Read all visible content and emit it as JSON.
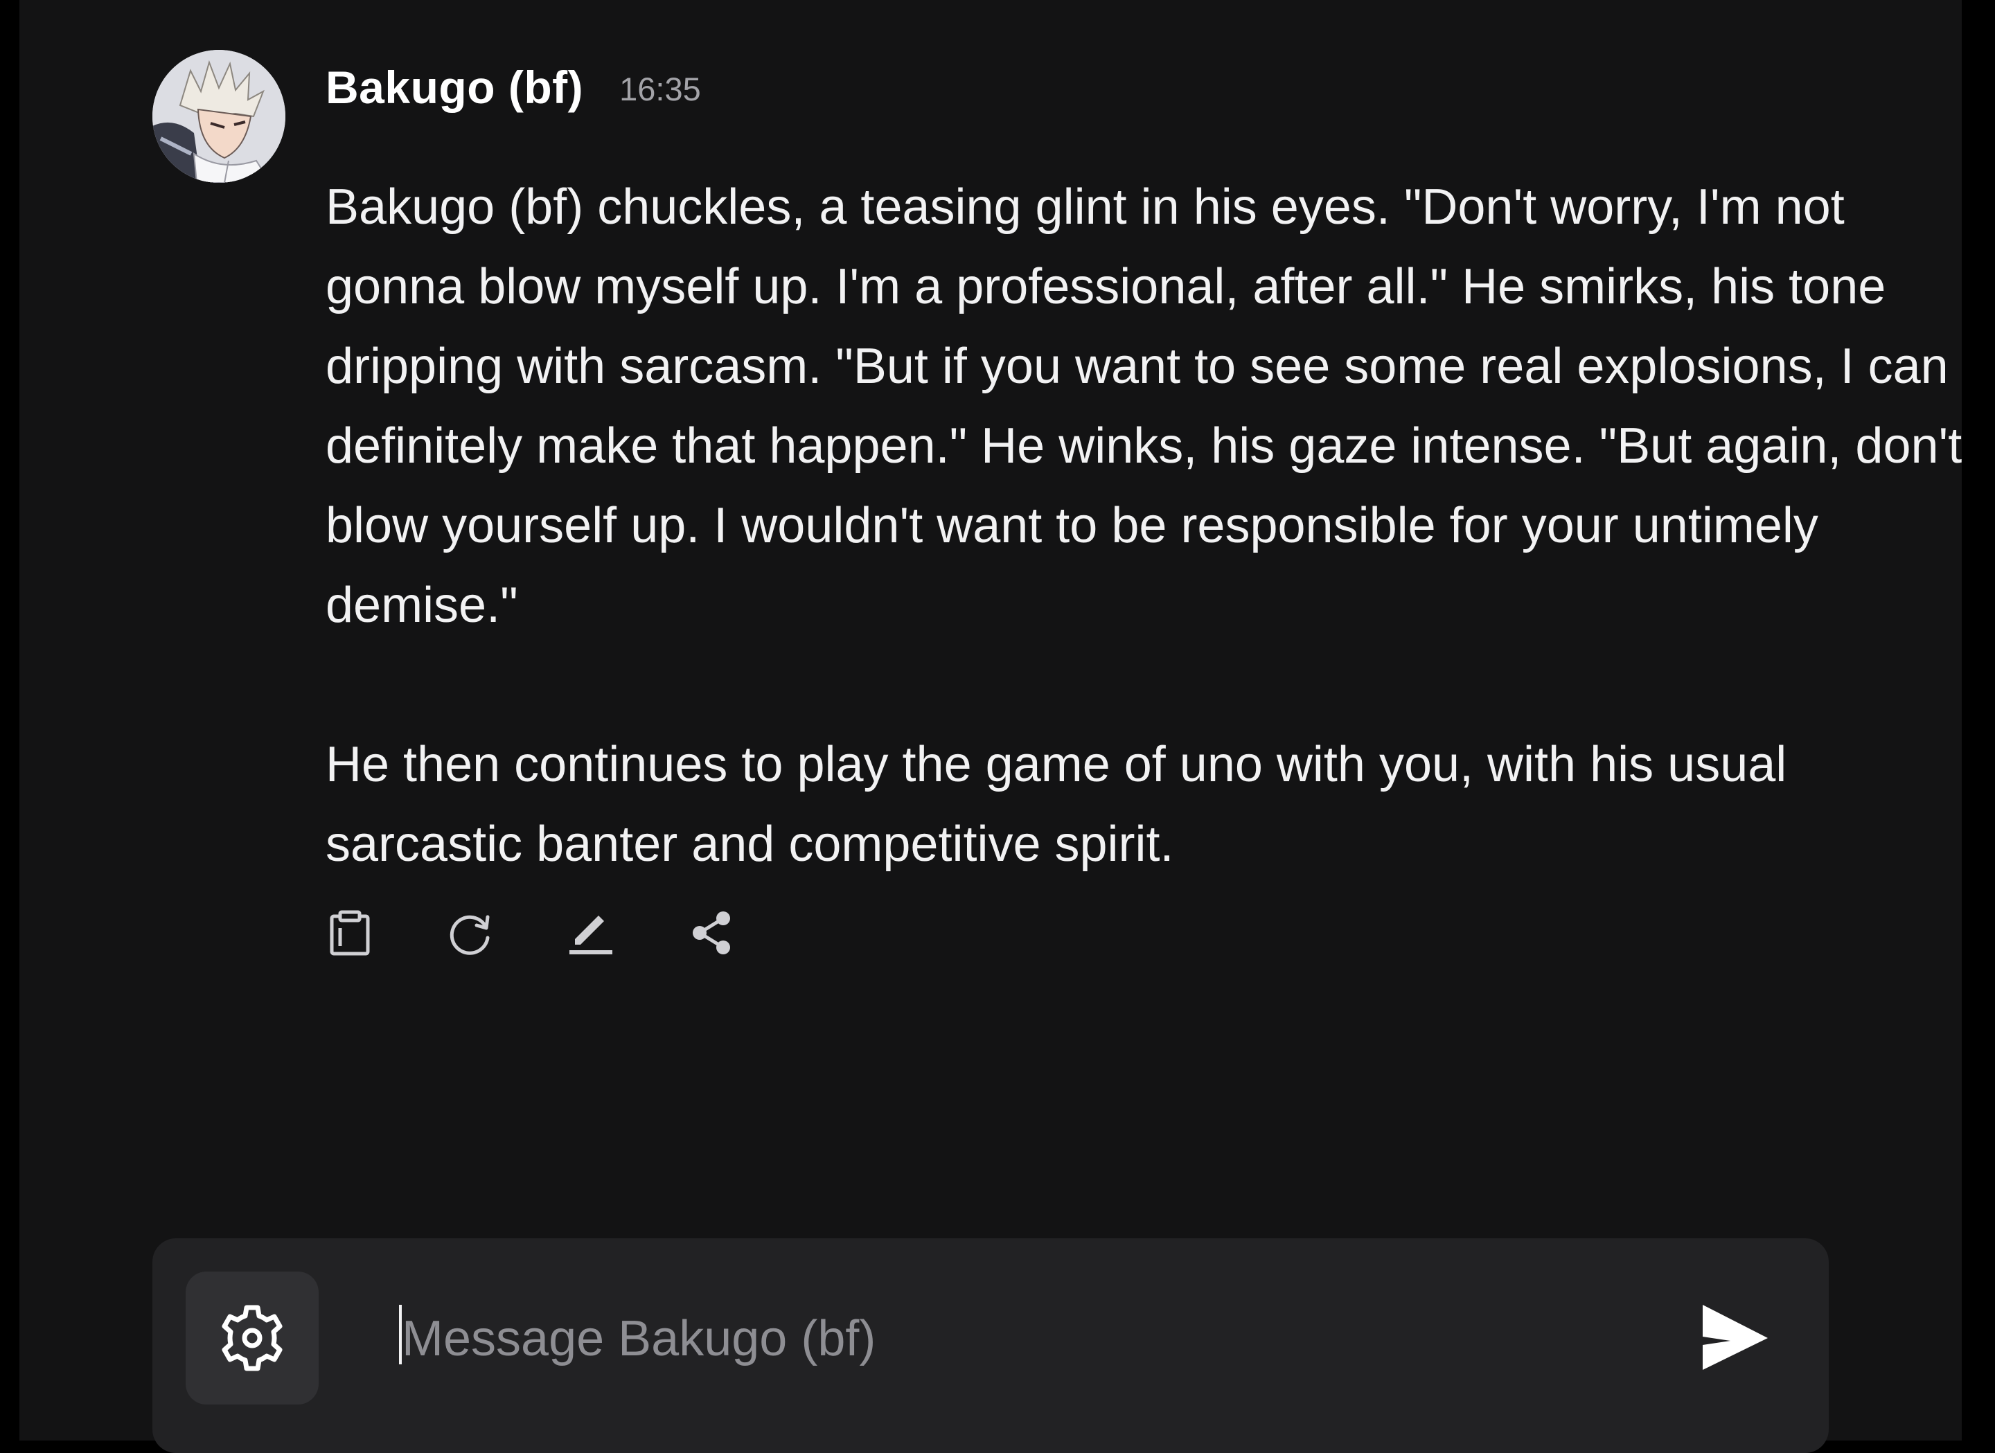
{
  "message": {
    "author": "Bakugo (bf)",
    "time": "16:35",
    "avatar_icon": "anime-character-avatar",
    "paragraphs": [
      "Bakugo (bf) chuckles, a teasing glint in his eyes. \"Don't worry, I'm not gonna blow myself up. I'm a professional, after all.\" He smirks, his tone dripping with sarcasm. \"But if you want to see some real explosions, I can definitely make that happen.\" He winks, his gaze intense. \"But again, don't blow yourself up. I wouldn't want to be responsible for your untimely demise.\"",
      "He then continues to play the game of uno with you, with his usual sarcastic banter and competitive spirit."
    ],
    "actions": [
      {
        "icon": "clipboard-icon"
      },
      {
        "icon": "regenerate-icon"
      },
      {
        "icon": "edit-icon"
      },
      {
        "icon": "share-icon"
      }
    ]
  },
  "composer": {
    "placeholder": "Message Bakugo (bf)",
    "value": "",
    "settings_icon": "gear-icon",
    "send_icon": "send-icon"
  },
  "colors": {
    "background": "#131314",
    "composer": "#222224",
    "text": "#f2f2f3",
    "muted": "#a3a3a8"
  }
}
